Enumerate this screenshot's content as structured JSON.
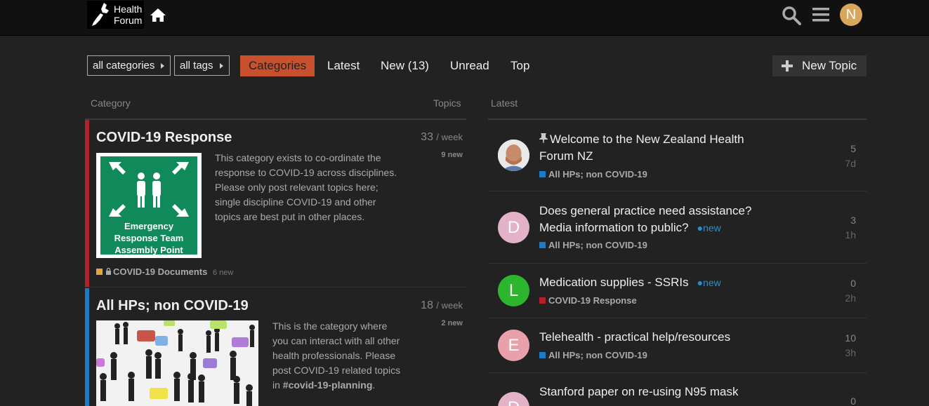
{
  "header": {
    "logo_line1": "Health",
    "logo_line2": "Forum",
    "user_initial": "N"
  },
  "filters": {
    "categories": "all categories",
    "tags": "all tags"
  },
  "nav": {
    "categories": "Categories",
    "latest": "Latest",
    "new": "New (13)",
    "unread": "Unread",
    "top": "Top"
  },
  "new_topic": "New Topic",
  "columns": {
    "category": "Category",
    "topics": "Topics",
    "latest": "Latest"
  },
  "categories": [
    {
      "title": "COVID-19 Response",
      "count": "33",
      "per": "/ week",
      "new": "9 new",
      "description": "This category exists to co-ordinate the response to COVID-19 across disciplines. Please only post relevant topics here; single discipline COVID-19 and other topics are best put in other places.",
      "image_lines": [
        "Emergency",
        "Response Team",
        "Assembly Point"
      ],
      "sub_name": "COVID-19 Documents",
      "sub_new": "6 new",
      "color": "#b3222a"
    },
    {
      "title": "All HPs; non COVID-19",
      "count": "18",
      "per": "/ week",
      "new": "2 new",
      "desc_text": "This is the category where you can interact with all other health professionals. Please post COVID-19 related topics in ",
      "desc_link": "#covid-19-planning",
      "desc_end": ".",
      "color": "#1f7ac2"
    }
  ],
  "topics": [
    {
      "title": "Welcome to the New Zealand Health Forum NZ",
      "category": "All HPs; non COVID-19",
      "replies": "5",
      "ago": "7d",
      "pinned": true
    },
    {
      "title": "Does general practice need assistance? Media information to public?",
      "new": "new",
      "category": "All HPs; non COVID-19",
      "replies": "3",
      "ago": "1h",
      "initial": "D"
    },
    {
      "title": "Medication supplies - SSRIs",
      "new": "new",
      "category": "COVID-19 Response",
      "replies": "0",
      "ago": "2h",
      "initial": "L"
    },
    {
      "title": "Telehealth - practical help/resources",
      "category": "All HPs; non COVID-19",
      "replies": "10",
      "ago": "3h",
      "initial": "E"
    },
    {
      "title": "Stanford paper on re-using N95 mask",
      "replies": "0",
      "initial": "D"
    }
  ],
  "colors": {
    "accent": "#c8502d",
    "covid": "#b3222a",
    "allhps": "#1f7ac2",
    "docs": "#e8a33d"
  }
}
